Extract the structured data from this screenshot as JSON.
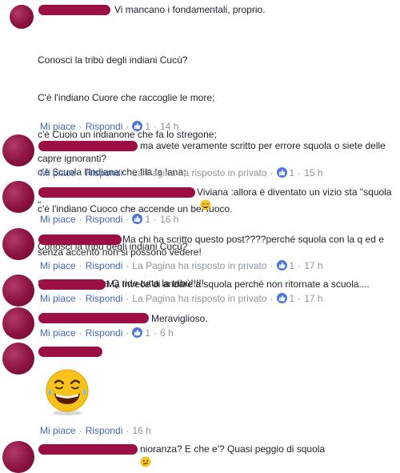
{
  "comments": [
    {
      "text": "Vi mancano i fondamentali, proprio.",
      "poem": [
        "Conosci la tribù degli indiani Cucù?",
        "C'è l'indiano Cuore che raccoglie le more;",
        "c'è Cuoio un indianone che fa lo stregone;",
        "c'è Scuola l'indiana che fila la lana;",
        "c'è l'indiano Cuoco che accende un bel fuoco.",
        "Conosci la tribù degli indiani Cucù?",
        "Se li scrivi con la Q ride tutta la tribù!!!!!"
      ],
      "like": "Mi piace",
      "reply": "Rispondi",
      "likes": "1",
      "time": "14 h"
    },
    {
      "text": "ma avete veramente scritto per errore squola o siete delle capre ignoranti?",
      "like": "Mi piace",
      "reply": "Rispondi",
      "page_reply": "La Pagina ha risposto in privato",
      "likes": "1",
      "time": "15 h"
    },
    {
      "text": "Viviana :allora è diventato un vizio sta \"squola \"",
      "like": "Mi piace",
      "reply": "Rispondi",
      "likes": "1",
      "time": "16 h"
    },
    {
      "text": "Ma chi ha scritto questo post????perché squola con la q ed e senza accento non si possono vedere!",
      "like": "Mi piace",
      "reply": "Rispondi",
      "page_reply": "La Pagina ha risposto in privato",
      "likes": "1",
      "time": "17 h"
    },
    {
      "text": "Ma invece di andare a squola perché non ritornate a scuola....",
      "like": "Mi piace",
      "reply": "Rispondi",
      "page_reply": "La Pagina ha risposto in privato",
      "likes": "1",
      "time": "17 h"
    },
    {
      "text": "Meraviglioso.",
      "like": "Mi piace",
      "reply": "Rispondi",
      "likes": "1",
      "time": "6 h"
    },
    {
      "text": "",
      "like": "Mi piace",
      "reply": "Rispondi",
      "time": "16 h"
    },
    {
      "text": "nioranza? E che e'? Quasi peggio di squola"
    }
  ],
  "colors": {
    "link": "#4267b2",
    "meta": "#8d949e",
    "like_badge": "#4c75d8",
    "redaction": "#9b0f45"
  }
}
